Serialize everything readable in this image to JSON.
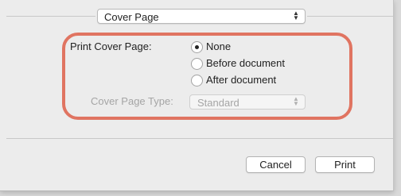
{
  "section_popup": {
    "value": "Cover Page",
    "arrows_icon": "updown-chevron-icon"
  },
  "cover_page": {
    "label": "Print Cover Page:",
    "options": [
      {
        "label": "None",
        "selected": true
      },
      {
        "label": "Before document",
        "selected": false
      },
      {
        "label": "After document",
        "selected": false
      }
    ]
  },
  "cover_type": {
    "label": "Cover Page Type:",
    "value": "Standard",
    "enabled": false
  },
  "buttons": {
    "cancel": "Cancel",
    "print": "Print"
  },
  "colors": {
    "highlight": "#e07461",
    "background": "#ececec"
  }
}
